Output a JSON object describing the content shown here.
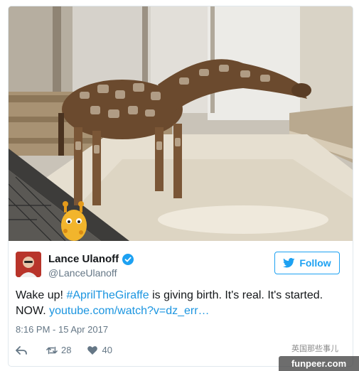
{
  "tweet": {
    "author": {
      "display_name": "Lance Ulanoff",
      "handle": "@LanceUlanoff",
      "verified": true
    },
    "follow_label": "Follow",
    "text_before": "Wake up! ",
    "hashtag": "#AprilTheGiraffe",
    "text_after": " is giving birth. It's real. It's started. NOW. ",
    "link": "youtube.com/watch?v=dz_err…",
    "timestamp": "8:16 PM - 15 Apr 2017",
    "retweet_count": "28",
    "like_count": "40"
  },
  "watermark": {
    "text": "funpeer.com",
    "chinese": "英国那些事儿"
  },
  "colors": {
    "accent": "#1da1f2",
    "link": "#1b95e0",
    "text": "#14171a",
    "muted": "#657786"
  },
  "icons": [
    "verified-icon",
    "twitter-bird-icon",
    "reply-icon",
    "retweet-icon",
    "like-icon",
    "giraffe-mascot-icon"
  ]
}
